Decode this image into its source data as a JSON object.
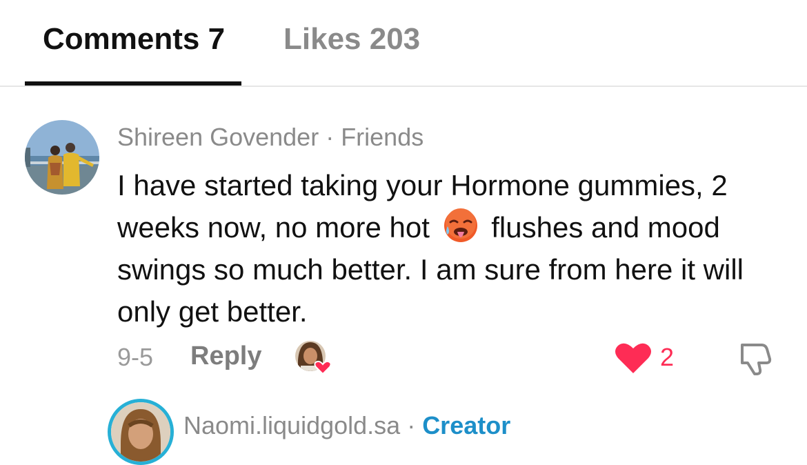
{
  "tabs": {
    "comments_label": "Comments 7",
    "likes_label": "Likes 203"
  },
  "comment": {
    "author": "Shireen Govender",
    "separator": " · ",
    "relation": "Friends",
    "text_part1": "I have started taking your Hormone gummies, 2 weeks now, no more hot",
    "emoji": "hot-face-emoji",
    "text_part2": "flushes and mood swings so much better. I am sure from here it will only get better.",
    "date": "9-5",
    "reply_label": "Reply",
    "like_count": "2"
  },
  "reply": {
    "author": "Naomi.liquidgold.sa",
    "separator": " · ",
    "badge": "Creator"
  },
  "colors": {
    "accent_red": "#fe2c55",
    "creator_blue": "#1d8fc9",
    "ring_blue": "#27b0d6"
  }
}
